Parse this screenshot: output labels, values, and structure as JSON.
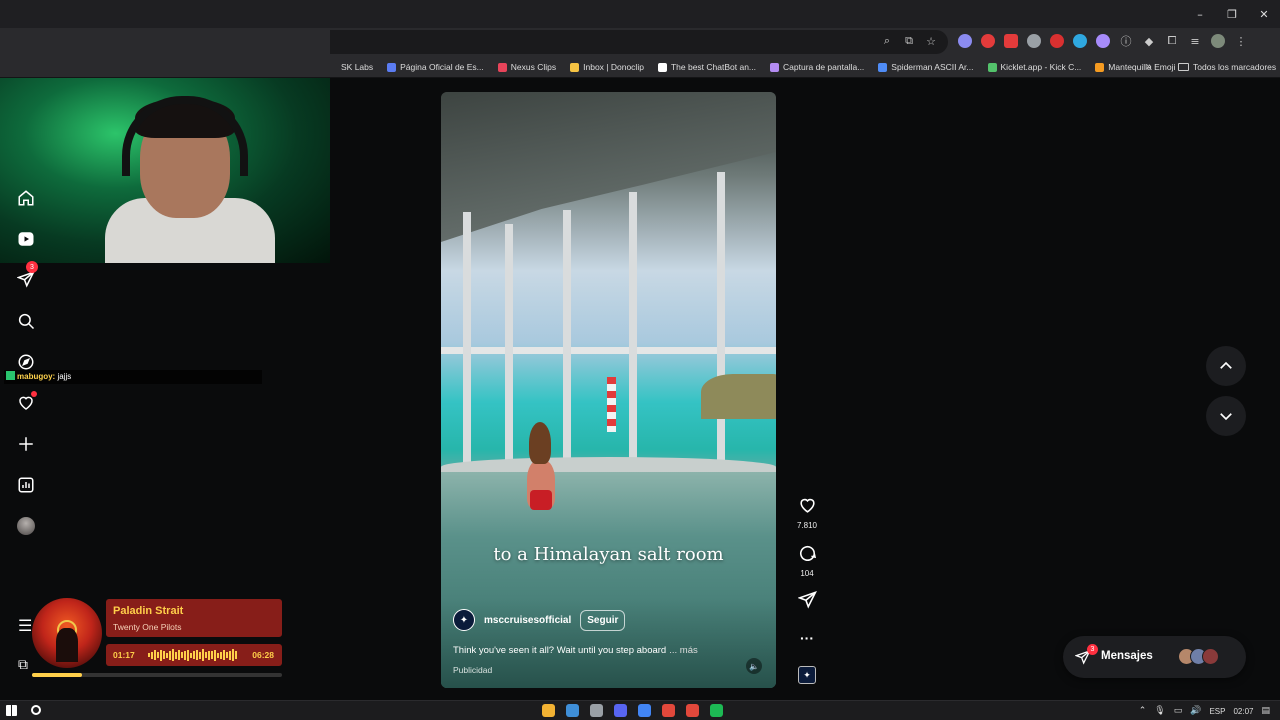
{
  "browser": {
    "window_controls": [
      "–",
      "❐",
      "✕"
    ],
    "bookmarks": [
      {
        "label": "SK Labs",
        "color": "#2a2a2d"
      },
      {
        "label": "Página Oficial de Es...",
        "color": "#5b7cf2"
      },
      {
        "label": "Nexus Clips",
        "color": "#e8445a"
      },
      {
        "label": "Inbox | Donoclip",
        "color": "#f6c343"
      },
      {
        "label": "The best ChatBot an...",
        "color": "#ffffff"
      },
      {
        "label": "Captura de pantalla...",
        "color": "#b48cf2"
      },
      {
        "label": "Spiderman ASCII Ar...",
        "color": "#4f8cf6"
      },
      {
        "label": "Kicklet.app - Kick C...",
        "color": "#53c26b"
      },
      {
        "label": "Mantequilla Emoji",
        "color": "#f59b21"
      }
    ],
    "bookmarks_more": "»",
    "all_bookmarks": "Todos los marcadores"
  },
  "chat_overlay": {
    "user": "mabugoy:",
    "message": "jajjs"
  },
  "nav": {
    "home_icon": "home-icon",
    "reels_icon": "reels-icon",
    "messages_badge": "3"
  },
  "reel": {
    "caption_overlay": "to a Himalayan salt room",
    "account": "msccruisesofficial",
    "follow_label": "Seguir",
    "description": "Think you've seen it all? Wait until you step aboard",
    "more_label": "... más",
    "sponsored_label": "Publicidad"
  },
  "actions": {
    "likes": "7.810",
    "comments": "104"
  },
  "messages_pill": {
    "label": "Mensajes",
    "badge": "3",
    "avatar_colors": [
      "#b5876a",
      "#6f7fa8",
      "#8a3a3a"
    ]
  },
  "music": {
    "title": "Paladin Strait",
    "artist": "Twenty One Pilots",
    "elapsed": "01:17",
    "duration": "06:28",
    "progress": 0.2
  },
  "taskbar": {
    "lang": "ESP",
    "time": "02:07",
    "app_colors": [
      "#f2b233",
      "#3f8fd8",
      "#9aa0a6",
      "#5865f2",
      "#4285f4",
      "#e2483b",
      "#e2483b",
      "#1db954"
    ]
  }
}
